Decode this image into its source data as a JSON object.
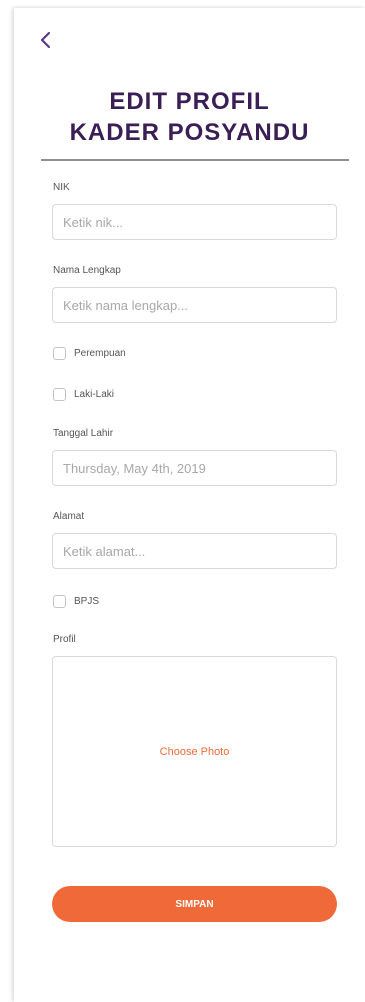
{
  "header": {
    "back_icon": "chevron-left-icon",
    "title_line1": "EDIT PROFIL",
    "title_line2": "KADER POSYANDU"
  },
  "form": {
    "nik": {
      "label": "NIK",
      "placeholder": "Ketik nik..."
    },
    "nama": {
      "label": "Nama Lengkap",
      "placeholder": "Ketik nama lengkap..."
    },
    "gender": {
      "options": [
        {
          "label": "Perempuan",
          "checked": false
        },
        {
          "label": "Laki-Laki",
          "checked": false
        }
      ]
    },
    "tanggal": {
      "label": "Tanggal Lahir",
      "placeholder": "Thursday, May 4th, 2019"
    },
    "alamat": {
      "label": "Alamat",
      "placeholder": "Ketik alamat..."
    },
    "bpjs": {
      "label": "BPJS",
      "checked": false
    },
    "profil": {
      "label": "Profil",
      "choose_label": "Choose Photo"
    },
    "submit_label": "SIMPAN"
  },
  "colors": {
    "title": "#3a1e56",
    "accent": "#ef6a38",
    "back_icon": "#5b3b85"
  }
}
